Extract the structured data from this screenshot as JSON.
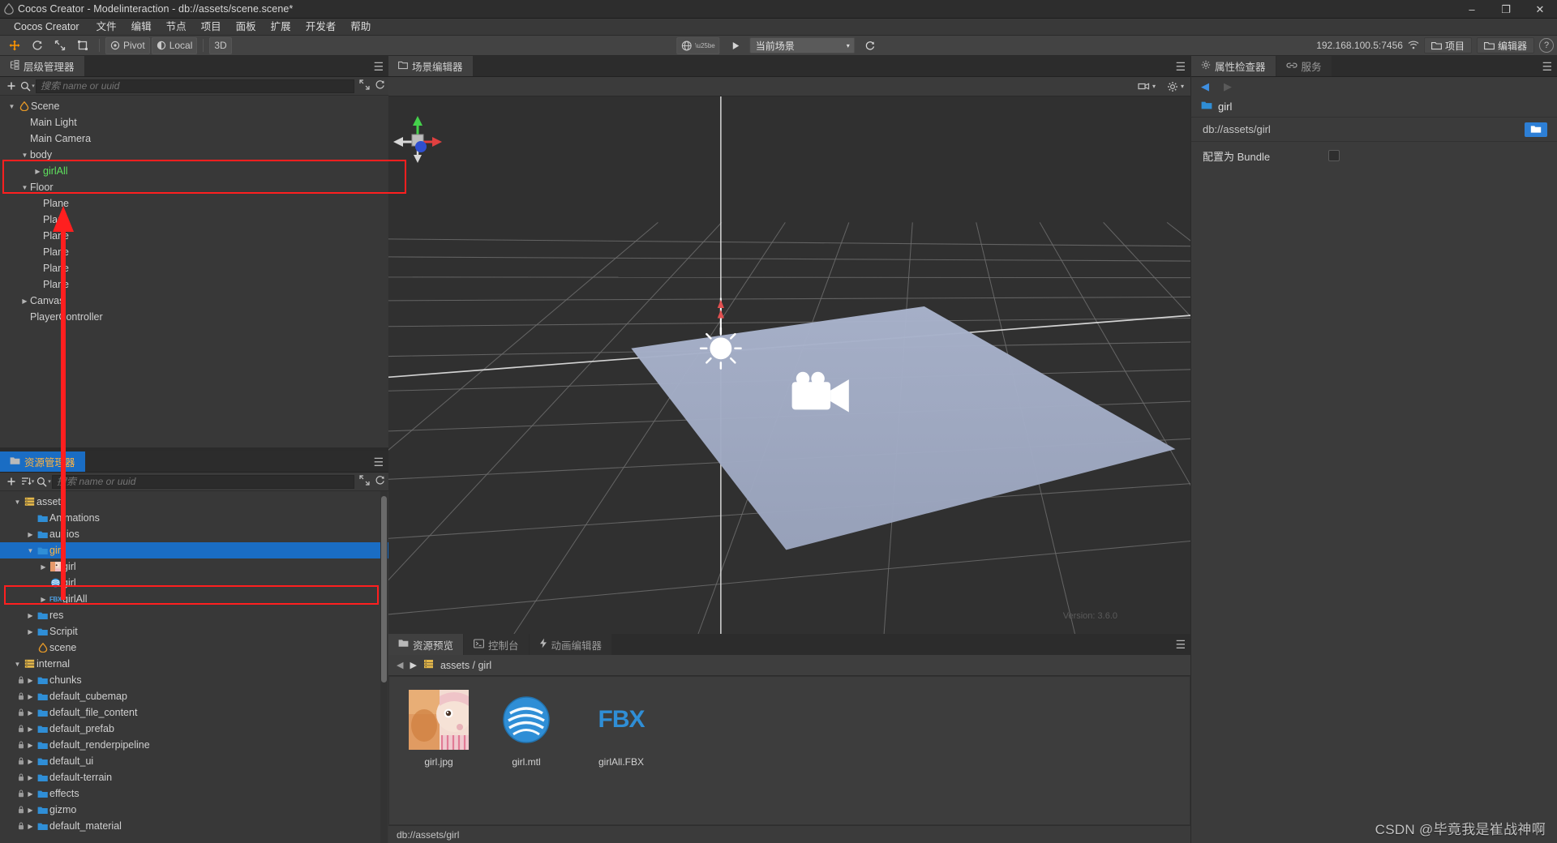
{
  "window": {
    "title": "Cocos Creator - Modelinteraction - db://assets/scene.scene*",
    "minimize": "–",
    "maximize": "❐",
    "close": "✕"
  },
  "menubar": {
    "items": [
      {
        "label": "Cocos Creator"
      },
      {
        "label": "文件"
      },
      {
        "label": "编辑"
      },
      {
        "label": "节点"
      },
      {
        "label": "项目"
      },
      {
        "label": "面板"
      },
      {
        "label": "扩展"
      },
      {
        "label": "开发者"
      },
      {
        "label": "帮助"
      }
    ]
  },
  "toolbar": {
    "pivot_label": "Pivot",
    "local_label": "Local",
    "dimension_label": "3D",
    "scene_select_value": "当前场景",
    "ip_address": "192.168.100.5:7456",
    "project_label": "项目",
    "editor_label": "编辑器",
    "help_label": "?"
  },
  "hierarchy": {
    "tab_label": "层级管理器",
    "search_placeholder": "搜索 name or uuid",
    "nodes": [
      {
        "label": "Scene",
        "indent": 0,
        "arrow": "down",
        "icon": "scene-drop-icon",
        "color": "normal"
      },
      {
        "label": "Main Light",
        "indent": 1,
        "arrow": "none",
        "icon": "none",
        "color": "normal"
      },
      {
        "label": "Main Camera",
        "indent": 1,
        "arrow": "none",
        "icon": "none",
        "color": "normal"
      },
      {
        "label": "body",
        "indent": 1,
        "arrow": "down",
        "icon": "none",
        "color": "normal"
      },
      {
        "label": "girlAll",
        "indent": 2,
        "arrow": "right",
        "icon": "none",
        "color": "green"
      },
      {
        "label": "Floor",
        "indent": 1,
        "arrow": "down",
        "icon": "none",
        "color": "normal"
      },
      {
        "label": "Plane",
        "indent": 2,
        "arrow": "none",
        "icon": "none",
        "color": "normal"
      },
      {
        "label": "Plane",
        "indent": 2,
        "arrow": "none",
        "icon": "none",
        "color": "normal"
      },
      {
        "label": "Plane",
        "indent": 2,
        "arrow": "none",
        "icon": "none",
        "color": "normal"
      },
      {
        "label": "Plane",
        "indent": 2,
        "arrow": "none",
        "icon": "none",
        "color": "normal"
      },
      {
        "label": "Plane",
        "indent": 2,
        "arrow": "none",
        "icon": "none",
        "color": "normal"
      },
      {
        "label": "Plane",
        "indent": 2,
        "arrow": "none",
        "icon": "none",
        "color": "normal"
      },
      {
        "label": "Canvas",
        "indent": 1,
        "arrow": "right",
        "icon": "none",
        "color": "normal"
      },
      {
        "label": "PlayerController",
        "indent": 1,
        "arrow": "none",
        "icon": "none",
        "color": "normal"
      }
    ]
  },
  "assets": {
    "tab_label": "资源管理器",
    "search_placeholder": "搜索 name or uuid",
    "nodes": [
      {
        "label": "assets",
        "indent": 0,
        "arrow": "down",
        "icon": "db-icon",
        "selected": false,
        "lock": false
      },
      {
        "label": "Animations",
        "indent": 1,
        "arrow": "none",
        "icon": "folder-icon",
        "selected": false,
        "lock": false
      },
      {
        "label": "audios",
        "indent": 1,
        "arrow": "right",
        "icon": "folder-icon",
        "selected": false,
        "lock": false
      },
      {
        "label": "girl",
        "indent": 1,
        "arrow": "down",
        "icon": "folder-icon",
        "selected": true,
        "lock": false
      },
      {
        "label": "girl",
        "indent": 2,
        "arrow": "right",
        "icon": "image-icon",
        "selected": false,
        "lock": false
      },
      {
        "label": "girl",
        "indent": 2,
        "arrow": "none",
        "icon": "material-icon",
        "selected": false,
        "lock": false
      },
      {
        "label": "girlAll",
        "indent": 2,
        "arrow": "right",
        "icon": "fbx-icon",
        "selected": false,
        "lock": false
      },
      {
        "label": "res",
        "indent": 1,
        "arrow": "right",
        "icon": "folder-icon",
        "selected": false,
        "lock": false
      },
      {
        "label": "Scripit",
        "indent": 1,
        "arrow": "right",
        "icon": "folder-icon",
        "selected": false,
        "lock": false
      },
      {
        "label": "scene",
        "indent": 1,
        "arrow": "none",
        "icon": "scene-drop-icon",
        "selected": false,
        "lock": false
      },
      {
        "label": "internal",
        "indent": 0,
        "arrow": "down",
        "icon": "db-icon",
        "selected": false,
        "lock": false
      },
      {
        "label": "chunks",
        "indent": 1,
        "arrow": "right",
        "icon": "folder-icon",
        "selected": false,
        "lock": true
      },
      {
        "label": "default_cubemap",
        "indent": 1,
        "arrow": "right",
        "icon": "folder-icon",
        "selected": false,
        "lock": true
      },
      {
        "label": "default_file_content",
        "indent": 1,
        "arrow": "right",
        "icon": "folder-icon",
        "selected": false,
        "lock": true
      },
      {
        "label": "default_prefab",
        "indent": 1,
        "arrow": "right",
        "icon": "folder-icon",
        "selected": false,
        "lock": true
      },
      {
        "label": "default_renderpipeline",
        "indent": 1,
        "arrow": "right",
        "icon": "folder-icon",
        "selected": false,
        "lock": true
      },
      {
        "label": "default_ui",
        "indent": 1,
        "arrow": "right",
        "icon": "folder-icon",
        "selected": false,
        "lock": true
      },
      {
        "label": "default-terrain",
        "indent": 1,
        "arrow": "right",
        "icon": "folder-icon",
        "selected": false,
        "lock": true
      },
      {
        "label": "effects",
        "indent": 1,
        "arrow": "right",
        "icon": "folder-icon",
        "selected": false,
        "lock": true
      },
      {
        "label": "gizmo",
        "indent": 1,
        "arrow": "right",
        "icon": "folder-icon",
        "selected": false,
        "lock": true
      },
      {
        "label": "default_material",
        "indent": 1,
        "arrow": "right",
        "icon": "folder-icon",
        "selected": false,
        "lock": true
      }
    ]
  },
  "scene_editor": {
    "tab_label": "场景编辑器",
    "gizmo_axis_x": "X",
    "gizmo_axis_y": "Y",
    "gizmo_axis_z": "Z"
  },
  "bottom": {
    "tabs": [
      {
        "label": "资源预览",
        "icon": "folder-icon",
        "active": true
      },
      {
        "label": "控制台",
        "icon": "console-icon",
        "active": false
      },
      {
        "label": "动画编辑器",
        "icon": "lightning-icon",
        "active": false
      }
    ],
    "breadcrumb": "assets / girl",
    "files": [
      {
        "name": "girl.jpg",
        "kind": "image"
      },
      {
        "name": "girl.mtl",
        "kind": "material"
      },
      {
        "name": "girlAll.FBX",
        "kind": "fbx"
      }
    ],
    "status_path": "db://assets/girl"
  },
  "inspector": {
    "tabs": [
      {
        "label": "属性检查器",
        "icon": "gear-icon",
        "active": true
      },
      {
        "label": "服务",
        "icon": "link-icon",
        "active": false
      }
    ],
    "asset_name": "girl",
    "asset_url": "db://assets/girl",
    "bundle_label": "配置为 Bundle",
    "bundle_checked": false
  },
  "overlay": {
    "watermark": "CSDN @毕竟我是崔战神啊",
    "version_text": "Version: 3.6.0",
    "highlight_color": "#ff1f1f",
    "accent_blue": "#1a6dc4",
    "accent_orange": "#ffb442"
  }
}
